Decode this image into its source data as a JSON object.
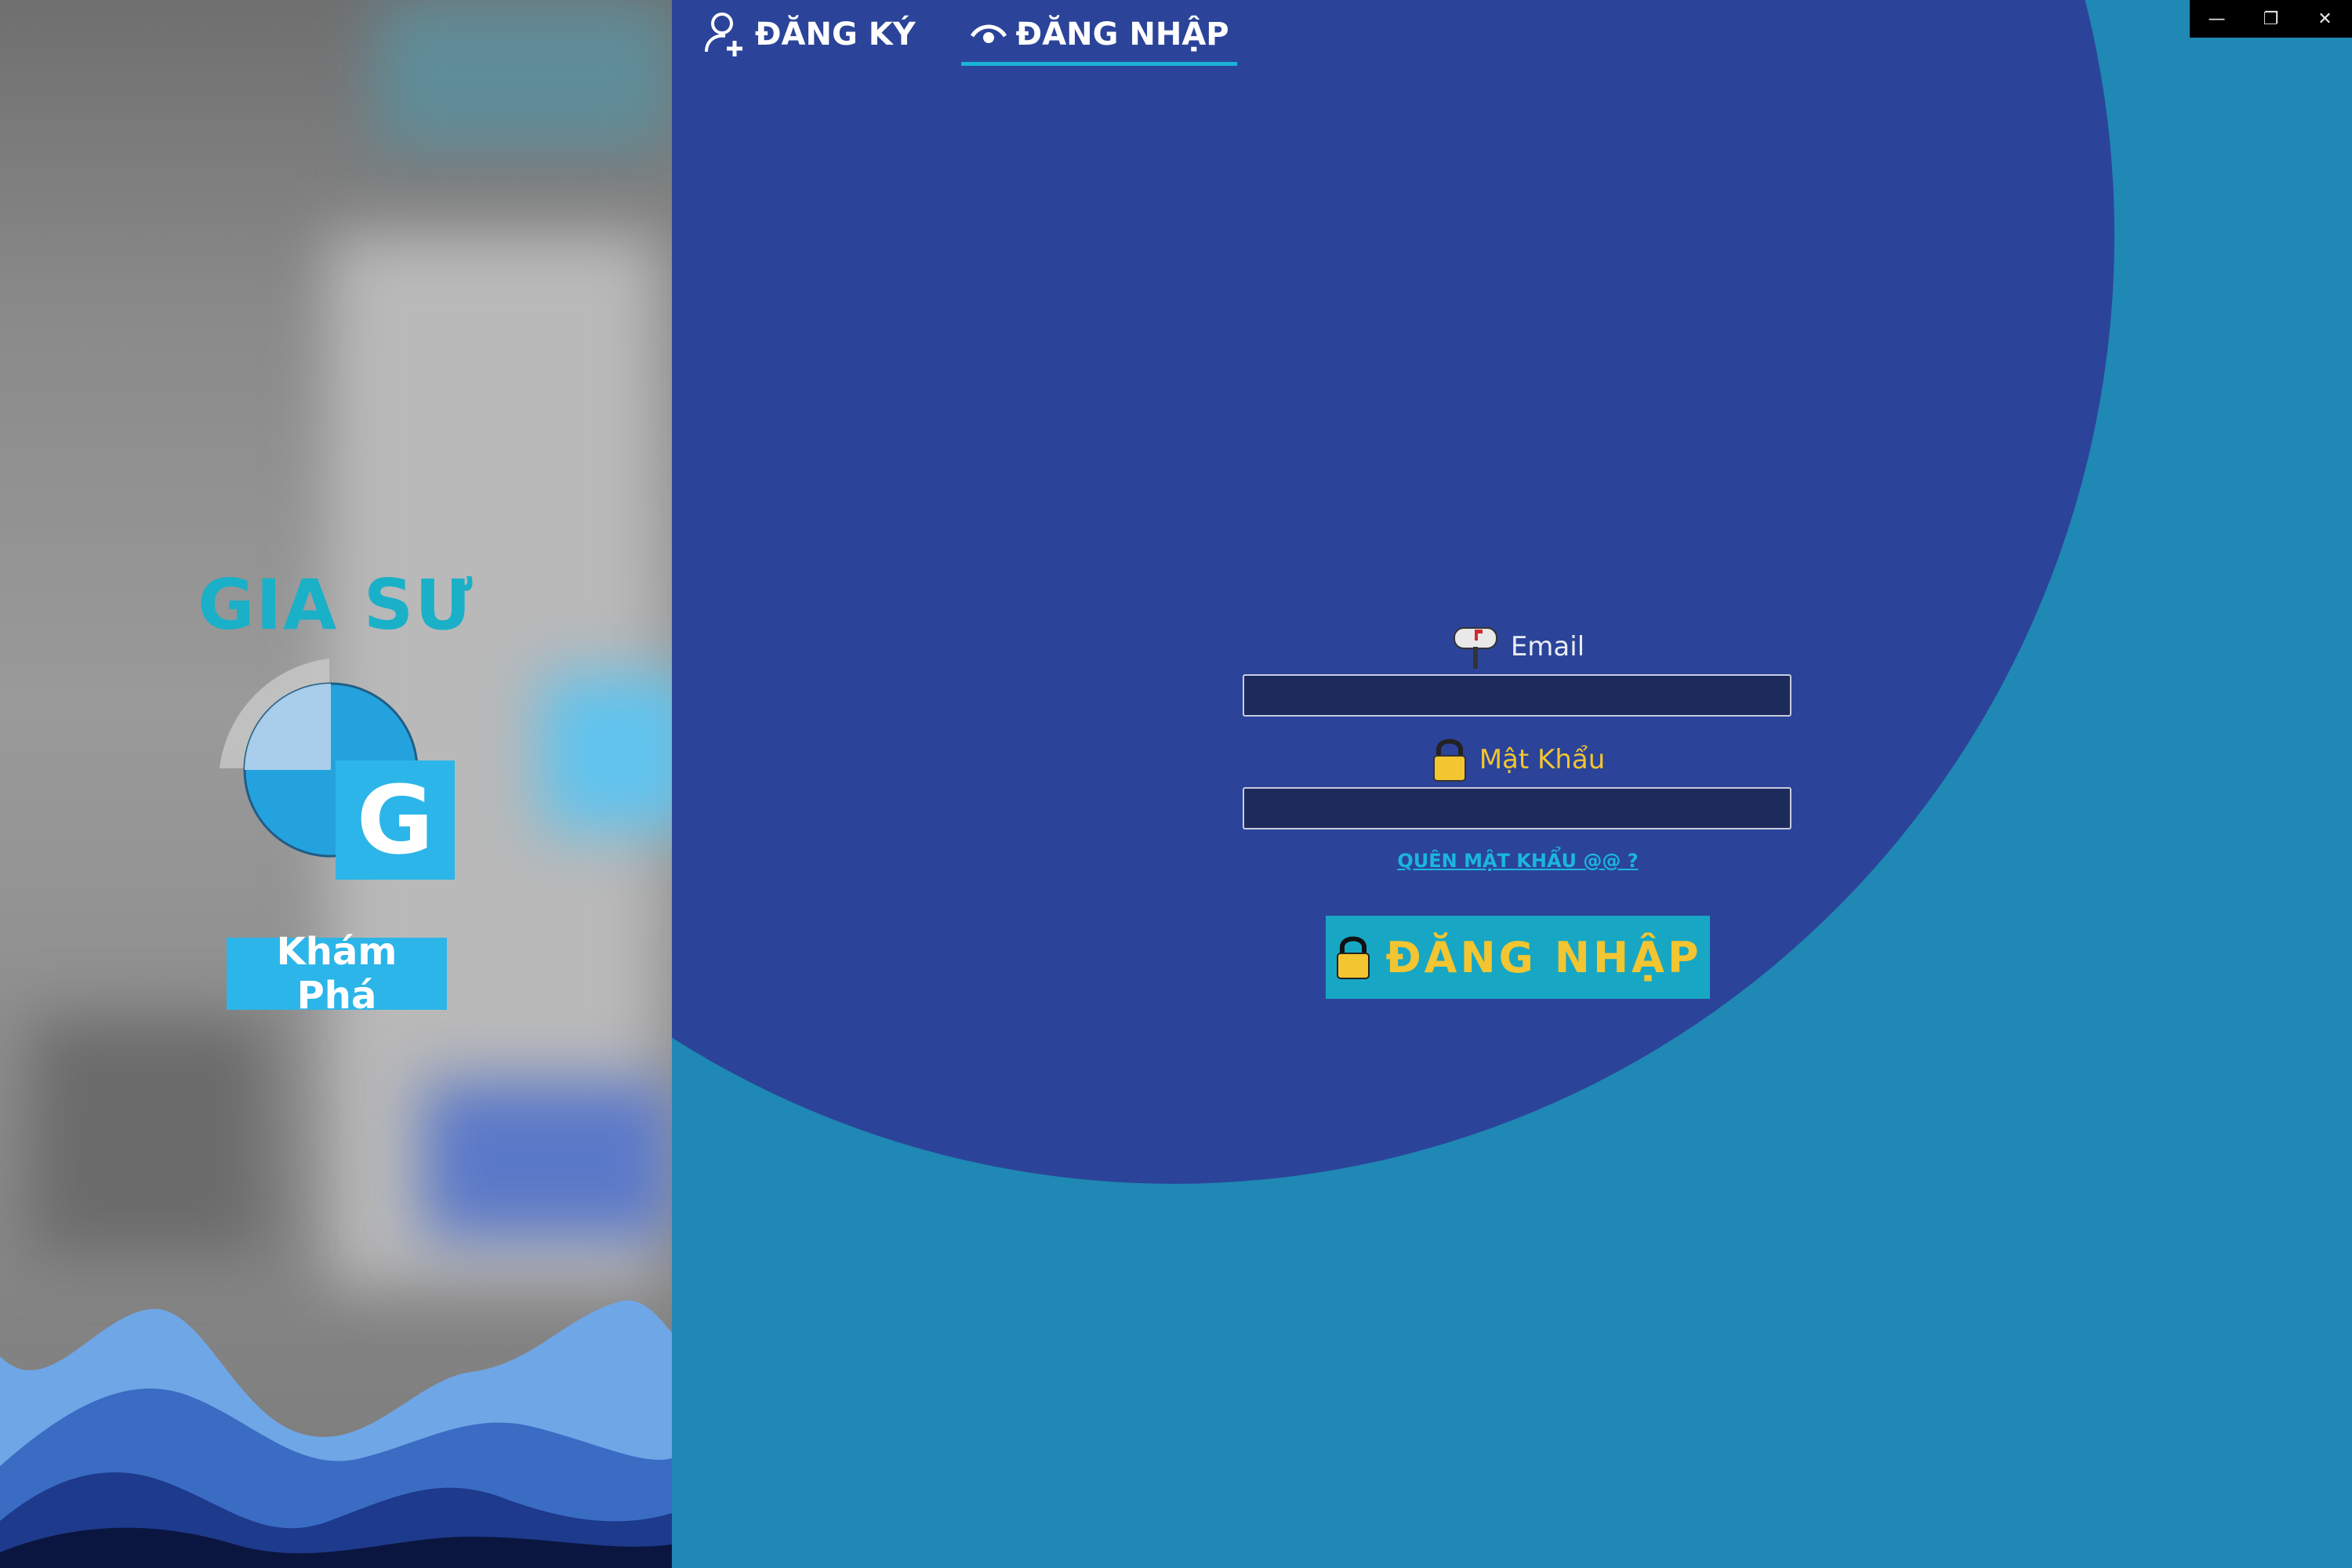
{
  "brand": {
    "title": "GIA SƯ",
    "logo_letter": "G",
    "explore_label": "Khám Phá"
  },
  "tabs": [
    {
      "label": "ĐĂNG KÝ",
      "icon": "add-user-icon",
      "active": false
    },
    {
      "label": "ĐĂNG NHẬP",
      "icon": "eye-icon",
      "active": true
    }
  ],
  "form": {
    "email_label": "Email",
    "email_icon": "mailbox-icon",
    "email_value": "",
    "password_label": "Mật Khẩu",
    "password_icon": "lock-icon",
    "password_value": "",
    "forgot_label": "QUÊN MẬT KHẨU @@ ?",
    "submit_label": "ĐĂNG NHẬP"
  },
  "window_controls": {
    "minimize": "—",
    "restore": "❐",
    "close": "✕"
  },
  "colors": {
    "circle": "#2b4499",
    "background": "#1f88b4",
    "accent": "#1bb3d6",
    "button_text": "#f2c531",
    "password_label": "#f2c531",
    "explore_button": "#2cb5e8"
  }
}
